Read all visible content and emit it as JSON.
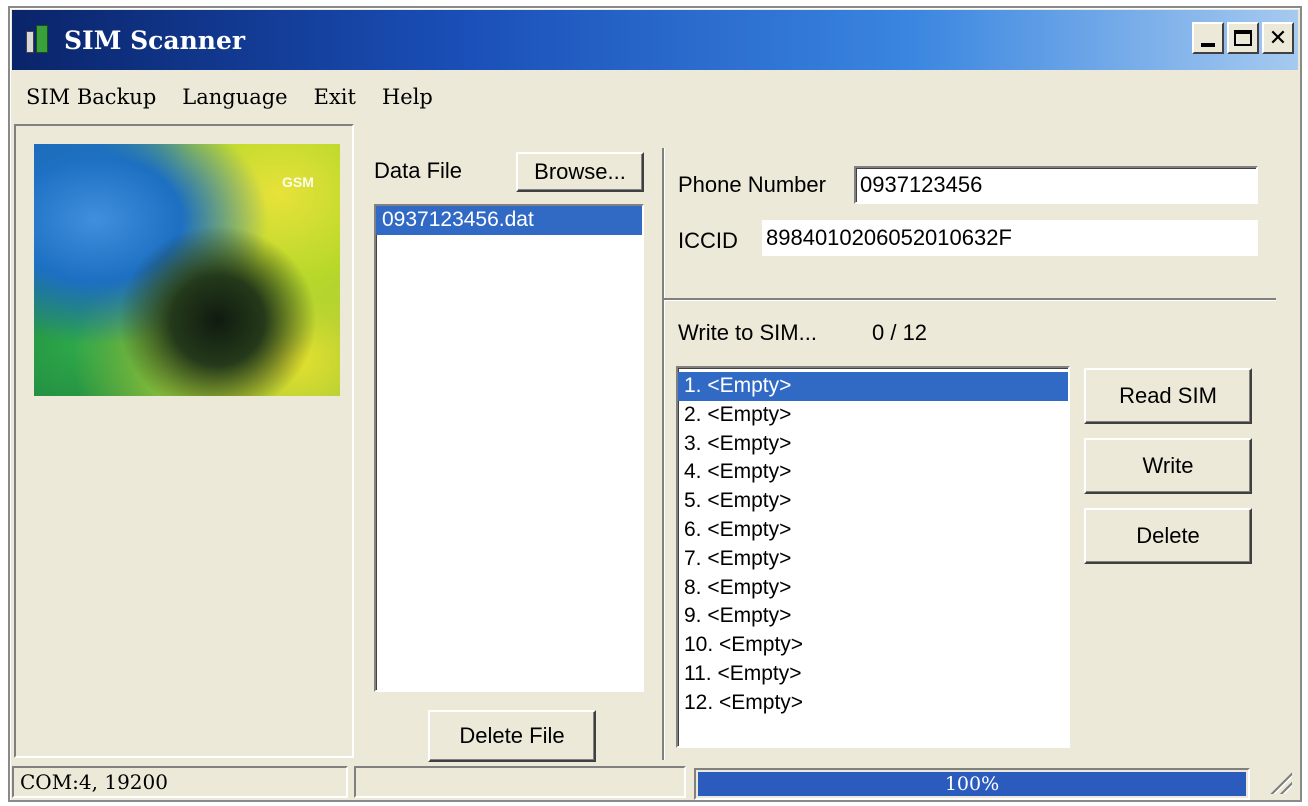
{
  "window": {
    "title": "SIM Scanner"
  },
  "menu": {
    "items": [
      {
        "label": "SIM Backup"
      },
      {
        "label": "Language"
      },
      {
        "label": "Exit"
      },
      {
        "label": "Help"
      }
    ]
  },
  "left": {
    "image_label": "GSM"
  },
  "data_file": {
    "label": "Data File",
    "browse_label": "Browse...",
    "files": [
      "0937123456.dat"
    ],
    "selected_index": 0,
    "delete_label": "Delete File"
  },
  "info": {
    "phone_label": "Phone Number",
    "phone_value": "0937123456",
    "iccid_label": "ICCID",
    "iccid_value": "898401020605201063 2F"
  },
  "write": {
    "label": "Write to SIM...",
    "progress_text": "0 / 12",
    "entries": [
      "1. <Empty>",
      "2. <Empty>",
      "3. <Empty>",
      "4. <Empty>",
      "5. <Empty>",
      "6. <Empty>",
      "7. <Empty>",
      "8. <Empty>",
      "9. <Empty>",
      "10. <Empty>",
      "11. <Empty>",
      "12. <Empty>"
    ],
    "selected_index": 0,
    "read_sim_label": "Read SIM",
    "write_label": "Write",
    "delete_label": "Delete"
  },
  "status": {
    "com_text": "COM:4, 19200",
    "progress_label": "100%",
    "progress_fraction": 1.0
  },
  "colors": {
    "title_start": "#0a246a",
    "title_end": "#a6caf0",
    "selection": "#316ac5",
    "progress": "#2a5bbd",
    "face": "#ece9d8"
  }
}
